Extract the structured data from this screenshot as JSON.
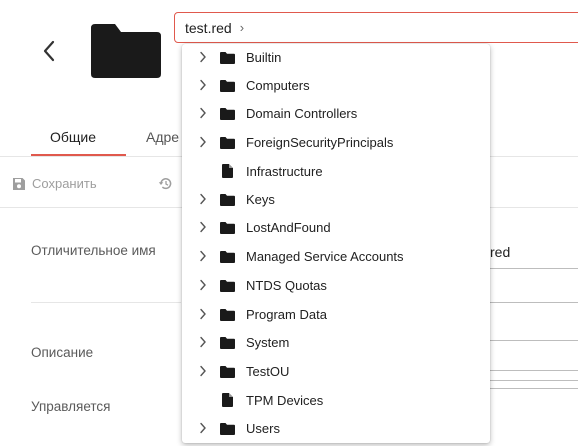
{
  "header": {
    "back_icon": "chevron-left-icon",
    "folder_icon": "folder-icon",
    "path_segment": "test.red",
    "path_chevron": "›"
  },
  "tabs": [
    {
      "label": "Общие",
      "active": true
    },
    {
      "label": "Адре",
      "active": false
    }
  ],
  "toolbar": {
    "save_label": "Сохранить",
    "save_icon": "floppy-disk-icon",
    "reset_icon": "history-icon"
  },
  "fields": {
    "distinguished_name_label": "Отличительное имя",
    "distinguished_name_value": "red",
    "description_label": "Описание",
    "managed_by_label": "Управляется"
  },
  "colors": {
    "accent": "#e0594d",
    "folder": "#1a1a1a",
    "muted": "#9e9e9e"
  },
  "dropdown": {
    "items": [
      {
        "label": "Builtin",
        "type": "folder",
        "expandable": true
      },
      {
        "label": "Computers",
        "type": "folder",
        "expandable": true
      },
      {
        "label": "Domain Controllers",
        "type": "folder",
        "expandable": true
      },
      {
        "label": "ForeignSecurityPrincipals",
        "type": "folder",
        "expandable": true
      },
      {
        "label": "Infrastructure",
        "type": "document",
        "expandable": false
      },
      {
        "label": "Keys",
        "type": "folder",
        "expandable": true
      },
      {
        "label": "LostAndFound",
        "type": "folder",
        "expandable": true
      },
      {
        "label": "Managed Service Accounts",
        "type": "folder",
        "expandable": true
      },
      {
        "label": "NTDS Quotas",
        "type": "folder",
        "expandable": true
      },
      {
        "label": "Program Data",
        "type": "folder",
        "expandable": true
      },
      {
        "label": "System",
        "type": "folder",
        "expandable": true
      },
      {
        "label": "TestOU",
        "type": "folder",
        "expandable": true
      },
      {
        "label": "TPM Devices",
        "type": "document",
        "expandable": false
      },
      {
        "label": "Users",
        "type": "folder",
        "expandable": true
      }
    ]
  }
}
